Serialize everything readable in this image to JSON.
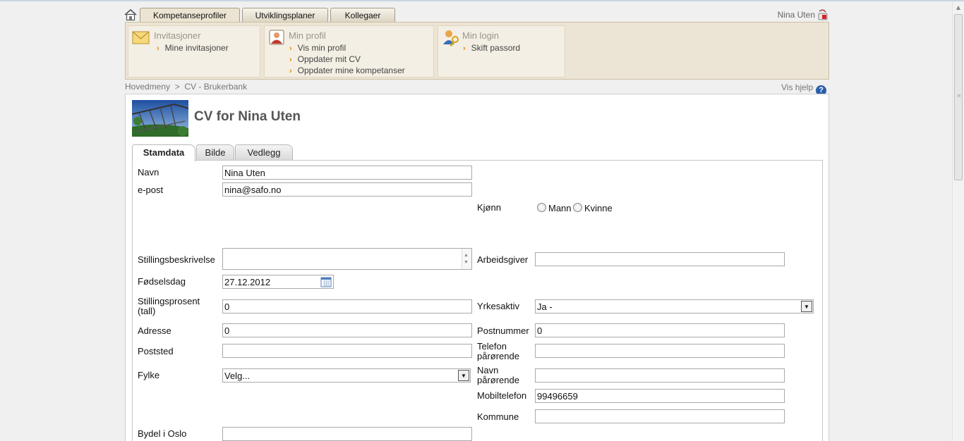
{
  "top_tabs": [
    "Kompetanseprofiler",
    "Utviklingsplaner",
    "Kollegaer"
  ],
  "user": {
    "name": "Nina Uten"
  },
  "menu": {
    "invitations": {
      "title": "Invitasjoner",
      "links": [
        "Mine invitasjoner"
      ]
    },
    "profile": {
      "title": "Min profil",
      "links": [
        "Vis min profil",
        "Oppdater mit CV",
        "Oppdater mine kompetanser"
      ]
    },
    "login": {
      "title": "Min login",
      "links": [
        "Skift passord"
      ]
    }
  },
  "breadcrumb": "Hovedmeny  >  CV - Brukerbank",
  "help_label": "Vis hjelp",
  "help_glyph": "?",
  "page_title": "CV for Nina Uten",
  "sub_tabs": [
    "Stamdata",
    "Bilde",
    "Vedlegg"
  ],
  "form": {
    "navn": {
      "label": "Navn",
      "value": "Nina Uten"
    },
    "epost": {
      "label": "e-post",
      "value": "nina@safo.no"
    },
    "kjonn": {
      "label": "Kjønn",
      "options": [
        "Mann",
        "Kvinne"
      ]
    },
    "stillingsbeskrivelse": {
      "label": "Stillingsbeskrivelse",
      "value": ""
    },
    "arbeidsgiver": {
      "label": "Arbeidsgiver",
      "value": ""
    },
    "fodselsdag": {
      "label": "Fødselsdag",
      "value": "27.12.2012"
    },
    "stillingsprosent": {
      "label_line1": "Stillingsprosent",
      "label_line2": "(tall)",
      "value": "0"
    },
    "yrkesaktiv": {
      "label": "Yrkesaktiv",
      "value": "Ja -"
    },
    "adresse": {
      "label": "Adresse",
      "value": "0"
    },
    "postnummer": {
      "label": "Postnummer",
      "value": "0"
    },
    "poststed": {
      "label": "Poststed",
      "value": ""
    },
    "telefon_parorende": {
      "label_line1": "Telefon",
      "label_line2": "pårørende",
      "value": ""
    },
    "fylke": {
      "label": "Fylke",
      "value": "Velg..."
    },
    "navn_parorende": {
      "label_line1": "Navn",
      "label_line2": "pårørende",
      "value": ""
    },
    "mobiltelefon": {
      "label": "Mobiltelefon",
      "value": "99496659"
    },
    "kommune": {
      "label": "Kommune",
      "value": ""
    },
    "bydel": {
      "label": "Bydel i Oslo",
      "value": ""
    }
  },
  "icons": {
    "home": "home-icon",
    "logout": "logout-icon",
    "envelope": "envelope-icon",
    "profile": "profile-icon",
    "login": "keys-user-icon",
    "calendar": "calendar-icon",
    "help": "help-icon"
  }
}
